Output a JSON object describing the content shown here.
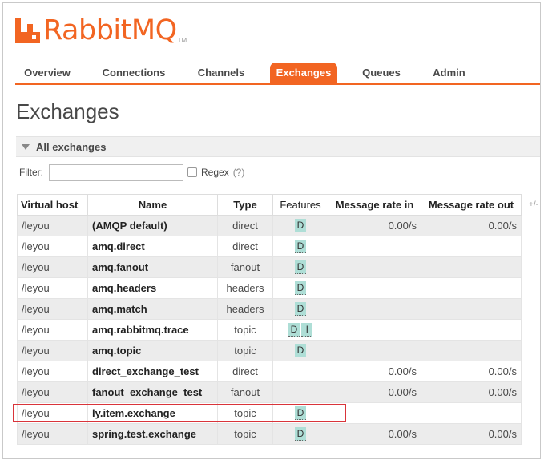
{
  "logo": {
    "text": "RabbitMQ",
    "tm": "TM",
    "color": "#f26522"
  },
  "nav": {
    "items": [
      {
        "label": "Overview",
        "active": false
      },
      {
        "label": "Connections",
        "active": false
      },
      {
        "label": "Channels",
        "active": false
      },
      {
        "label": "Exchanges",
        "active": true
      },
      {
        "label": "Queues",
        "active": false
      },
      {
        "label": "Admin",
        "active": false
      }
    ]
  },
  "page": {
    "title": "Exchanges"
  },
  "section": {
    "label": "All exchanges"
  },
  "filter": {
    "label": "Filter:",
    "value": "",
    "regex_label": "Regex",
    "regex_help": "(?)"
  },
  "table": {
    "columns": [
      "Virtual host",
      "Name",
      "Type",
      "Features",
      "Message rate in",
      "Message rate out"
    ],
    "plus_minus": "+/-",
    "rows": [
      {
        "vhost": "/leyou",
        "name": "(AMQP default)",
        "type": "direct",
        "features": [
          "D"
        ],
        "rate_in": "0.00/s",
        "rate_out": "0.00/s"
      },
      {
        "vhost": "/leyou",
        "name": "amq.direct",
        "type": "direct",
        "features": [
          "D"
        ],
        "rate_in": "",
        "rate_out": ""
      },
      {
        "vhost": "/leyou",
        "name": "amq.fanout",
        "type": "fanout",
        "features": [
          "D"
        ],
        "rate_in": "",
        "rate_out": ""
      },
      {
        "vhost": "/leyou",
        "name": "amq.headers",
        "type": "headers",
        "features": [
          "D"
        ],
        "rate_in": "",
        "rate_out": ""
      },
      {
        "vhost": "/leyou",
        "name": "amq.match",
        "type": "headers",
        "features": [
          "D"
        ],
        "rate_in": "",
        "rate_out": ""
      },
      {
        "vhost": "/leyou",
        "name": "amq.rabbitmq.trace",
        "type": "topic",
        "features": [
          "D",
          "I"
        ],
        "rate_in": "",
        "rate_out": ""
      },
      {
        "vhost": "/leyou",
        "name": "amq.topic",
        "type": "topic",
        "features": [
          "D"
        ],
        "rate_in": "",
        "rate_out": ""
      },
      {
        "vhost": "/leyou",
        "name": "direct_exchange_test",
        "type": "direct",
        "features": [],
        "rate_in": "0.00/s",
        "rate_out": "0.00/s"
      },
      {
        "vhost": "/leyou",
        "name": "fanout_exchange_test",
        "type": "fanout",
        "features": [],
        "rate_in": "0.00/s",
        "rate_out": "0.00/s"
      },
      {
        "vhost": "/leyou",
        "name": "ly.item.exchange",
        "type": "topic",
        "features": [
          "D"
        ],
        "rate_in": "",
        "rate_out": ""
      },
      {
        "vhost": "/leyou",
        "name": "spring.test.exchange",
        "type": "topic",
        "features": [
          "D"
        ],
        "rate_in": "0.00/s",
        "rate_out": "0.00/s"
      }
    ]
  },
  "colors": {
    "accent": "#f26522",
    "badge": "#aeded6",
    "highlight": "#d9343a"
  }
}
